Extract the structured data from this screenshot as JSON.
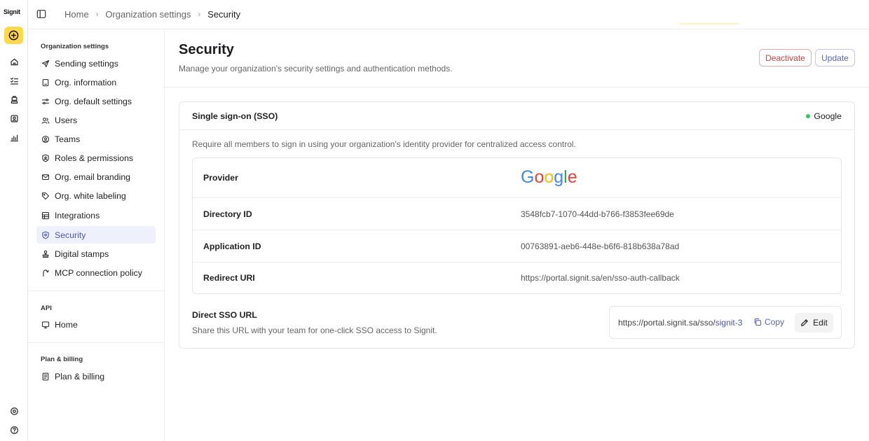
{
  "app": {
    "logo_text": "Signit"
  },
  "breadcrumb": [
    "Home",
    "Organization settings",
    "Security"
  ],
  "sidebar": {
    "sections": {
      "org": "Organization settings",
      "api": "API",
      "billing": "Plan & billing"
    },
    "org_items": [
      {
        "label": "Sending settings",
        "icon": "send-icon"
      },
      {
        "label": "Org. information",
        "icon": "document-icon"
      },
      {
        "label": "Org. default settings",
        "icon": "toggles-icon"
      },
      {
        "label": "Users",
        "icon": "users-icon"
      },
      {
        "label": "Teams",
        "icon": "team-icon"
      },
      {
        "label": "Roles & permissions",
        "icon": "shield-user-icon"
      },
      {
        "label": "Org. email branding",
        "icon": "mail-icon"
      },
      {
        "label": "Org. white labeling",
        "icon": "tag-icon"
      },
      {
        "label": "Integrations",
        "icon": "grid-icon"
      },
      {
        "label": "Security",
        "icon": "shield-icon",
        "active": true
      },
      {
        "label": "Digital stamps",
        "icon": "stamp-icon"
      },
      {
        "label": "MCP connection policy",
        "icon": "link-icon"
      }
    ],
    "api_items": [
      {
        "label": "Home",
        "icon": "monitor-icon"
      }
    ],
    "billing_items": [
      {
        "label": "Plan & billing",
        "icon": "receipt-icon"
      }
    ]
  },
  "page": {
    "title": "Security",
    "subtitle": "Manage your organization's security settings and authentication methods.",
    "deactivate_label": "Deactivate",
    "update_label": "Update"
  },
  "sso": {
    "title": "Single sign-on (SSO)",
    "status_label": "Google",
    "description": "Require all members to sign in using your organization's identity provider for centralized access control.",
    "rows": {
      "provider_label": "Provider",
      "provider_logo_text": "Google",
      "directory_label": "Directory ID",
      "directory_value": "3548fcb7-1070-44dd-b766-f3853fee69de",
      "application_label": "Application ID",
      "application_value": "00763891-aeb6-448e-b6f6-818b638a78ad",
      "redirect_label": "Redirect URI",
      "redirect_value": "https://portal.signit.sa/en/sso-auth-callback"
    },
    "direct": {
      "title": "Direct SSO URL",
      "subtitle": "Share this URL with your team for one-click SSO access to Signit.",
      "url_base": "https://portal.signit.sa/sso/",
      "url_slug": "signit-3",
      "copy_label": "Copy",
      "edit_label": "Edit"
    }
  },
  "colors": {
    "accent": "#4b55b8",
    "danger": "#c9413e",
    "brand_yellow": "#ffd84d",
    "status_green": "#34c759"
  }
}
